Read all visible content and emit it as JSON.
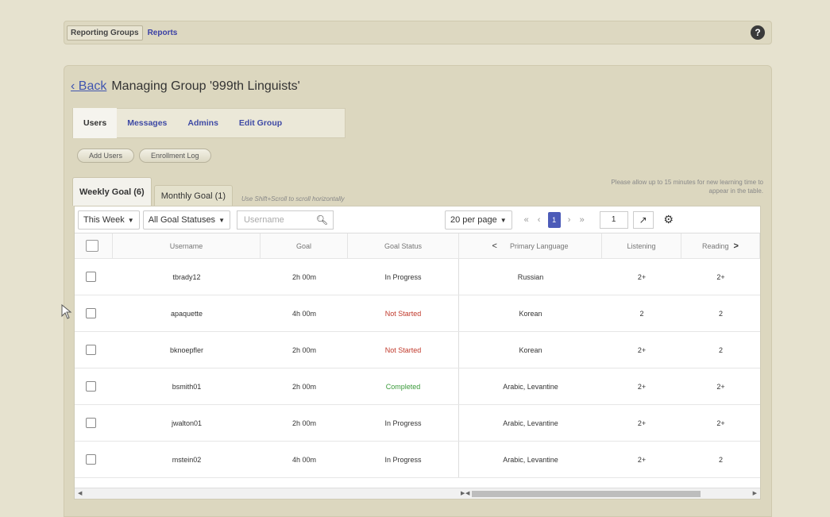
{
  "topnav": {
    "tabs": [
      {
        "label": "Reporting Groups",
        "active": true
      },
      {
        "label": "Reports",
        "active": false
      }
    ],
    "help_icon": "?"
  },
  "heading": {
    "back_label": "‹ Back",
    "title": "Managing Group '999th Linguists'"
  },
  "subtabs": [
    {
      "label": "Users",
      "active": true
    },
    {
      "label": "Messages",
      "active": false
    },
    {
      "label": "Admins",
      "active": false
    },
    {
      "label": "Edit Group",
      "active": false
    }
  ],
  "buttons": {
    "add_users": "Add Users",
    "enrollment_log": "Enrollment Log"
  },
  "goal_tabs": [
    {
      "label": "Weekly Goal (6)",
      "active": true
    },
    {
      "label": "Monthly Goal (1)",
      "active": false
    }
  ],
  "scroll_hint": "Use Shift+Scroll to scroll horizontally",
  "time_note": "Please allow up to 15 minutes for new learning time to appear in the table.",
  "toolbar": {
    "period": "This Week",
    "status_filter": "All Goal Statuses",
    "search_placeholder": "Username",
    "per_page": "20 per page",
    "current_page": "1",
    "page_input": "1",
    "first": "«",
    "prev": "‹",
    "next": "›",
    "last": "»"
  },
  "table": {
    "columns": [
      "Username",
      "Goal",
      "Goal Status",
      "Primary Language",
      "Listening",
      "Reading"
    ],
    "rows": [
      {
        "username": "tbrady12",
        "goal": "2h 00m",
        "status": "In Progress",
        "status_kind": "progress",
        "language": "Russian",
        "listening": "2+",
        "reading": "2+"
      },
      {
        "username": "apaquette",
        "goal": "4h 00m",
        "status": "Not Started",
        "status_kind": "notstarted",
        "language": "Korean",
        "listening": "2",
        "reading": "2"
      },
      {
        "username": "bknoepfler",
        "goal": "2h 00m",
        "status": "Not Started",
        "status_kind": "notstarted",
        "language": "Korean",
        "listening": "2+",
        "reading": "2"
      },
      {
        "username": "bsmith01",
        "goal": "2h 00m",
        "status": "Completed",
        "status_kind": "completed",
        "language": "Arabic, Levantine",
        "listening": "2+",
        "reading": "2+"
      },
      {
        "username": "jwalton01",
        "goal": "2h 00m",
        "status": "In Progress",
        "status_kind": "progress",
        "language": "Arabic, Levantine",
        "listening": "2+",
        "reading": "2+"
      },
      {
        "username": "mstein02",
        "goal": "4h 00m",
        "status": "In Progress",
        "status_kind": "progress",
        "language": "Arabic, Levantine",
        "listening": "2+",
        "reading": "2"
      }
    ]
  },
  "colors": {
    "accent": "#4c5bb8",
    "not_started": "#c0392b",
    "completed": "#3a9a3a"
  }
}
